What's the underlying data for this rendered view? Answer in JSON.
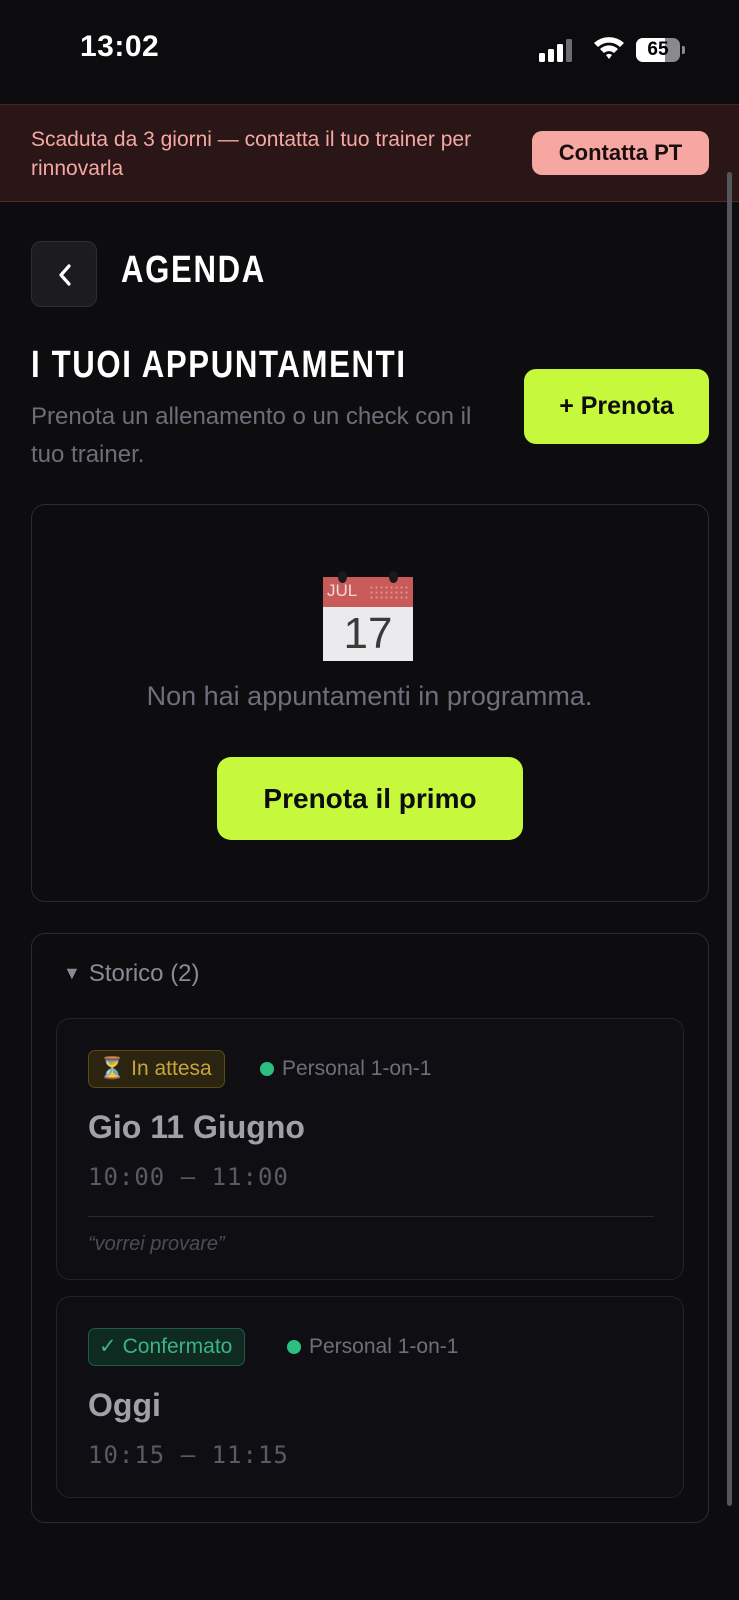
{
  "status_bar": {
    "time": "13:02",
    "battery": "65",
    "battery_level_percent": 65
  },
  "banner": {
    "message": "Scaduta da 3 giorni — contatta il tuo trainer per rinnovarla",
    "button": "Contatta PT"
  },
  "header": {
    "title": "AGENDA"
  },
  "section": {
    "title": "I TUOI APPUNTAMENTI",
    "subtitle": "Prenota un allenamento o un check con il tuo trainer.",
    "book_button": "+ Prenota"
  },
  "empty_state": {
    "calendar_month": "JUL",
    "calendar_day": "17",
    "message": "Non hai appuntamenti in programma.",
    "button": "Prenota il primo"
  },
  "history": {
    "label": "Storico (2)",
    "toggle_icon": "▼",
    "appointments": [
      {
        "status_icon": "⏳",
        "status": "In attesa",
        "type": "Personal 1-on-1",
        "date": "Gio 11 Giugno",
        "time": "10:00 — 11:00",
        "note": "“vorrei provare”"
      },
      {
        "status_icon": "✓",
        "status": "Confermato",
        "type": "Personal 1-on-1",
        "date": "Oggi",
        "time": "10:15 — 11:15"
      }
    ]
  },
  "colors": {
    "background": "#0d0d10",
    "accent": "#c6f83c",
    "banner_bg": "#2a1517",
    "banner_text": "#f6a8a3",
    "pending": "#c8a43a",
    "confirmed": "#3bb383"
  }
}
